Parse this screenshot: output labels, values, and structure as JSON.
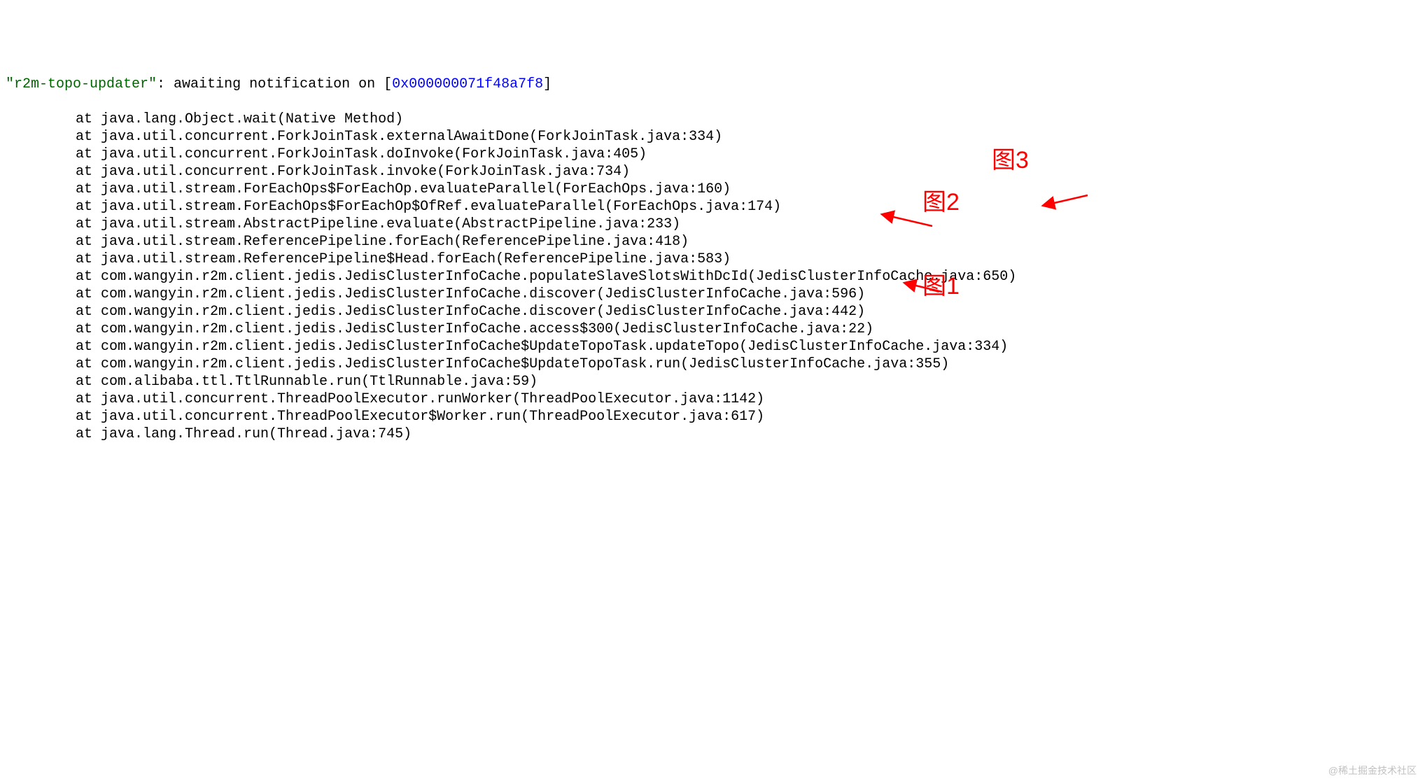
{
  "header": {
    "thread_name": "\"r2m-topo-updater\"",
    "mid_text": ": awaiting notification on [",
    "hex": "0x000000071f48a7f8",
    "end_text": "]"
  },
  "stack": [
    "at java.lang.Object.wait(Native Method)",
    "at java.util.concurrent.ForkJoinTask.externalAwaitDone(ForkJoinTask.java:334)",
    "at java.util.concurrent.ForkJoinTask.doInvoke(ForkJoinTask.java:405)",
    "at java.util.concurrent.ForkJoinTask.invoke(ForkJoinTask.java:734)",
    "at java.util.stream.ForEachOps$ForEachOp.evaluateParallel(ForEachOps.java:160)",
    "at java.util.stream.ForEachOps$ForEachOp$OfRef.evaluateParallel(ForEachOps.java:174)",
    "at java.util.stream.AbstractPipeline.evaluate(AbstractPipeline.java:233)",
    "at java.util.stream.ReferencePipeline.forEach(ReferencePipeline.java:418)",
    "at java.util.stream.ReferencePipeline$Head.forEach(ReferencePipeline.java:583)",
    "at com.wangyin.r2m.client.jedis.JedisClusterInfoCache.populateSlaveSlotsWithDcId(JedisClusterInfoCache.java:650)",
    "at com.wangyin.r2m.client.jedis.JedisClusterInfoCache.discover(JedisClusterInfoCache.java:596)",
    "at com.wangyin.r2m.client.jedis.JedisClusterInfoCache.discover(JedisClusterInfoCache.java:442)",
    "at com.wangyin.r2m.client.jedis.JedisClusterInfoCache.access$300(JedisClusterInfoCache.java:22)",
    "at com.wangyin.r2m.client.jedis.JedisClusterInfoCache$UpdateTopoTask.updateTopo(JedisClusterInfoCache.java:334)",
    "at com.wangyin.r2m.client.jedis.JedisClusterInfoCache$UpdateTopoTask.run(JedisClusterInfoCache.java:355)",
    "at com.alibaba.ttl.TtlRunnable.run(TtlRunnable.java:59)",
    "at java.util.concurrent.ThreadPoolExecutor.runWorker(ThreadPoolExecutor.java:1142)",
    "at java.util.concurrent.ThreadPoolExecutor$Worker.run(ThreadPoolExecutor.java:617)",
    "at java.lang.Thread.run(Thread.java:745)"
  ],
  "annotations": {
    "label1": "图1",
    "label2": "图2",
    "label3": "图3"
  },
  "watermark": "@稀土掘金技术社区"
}
